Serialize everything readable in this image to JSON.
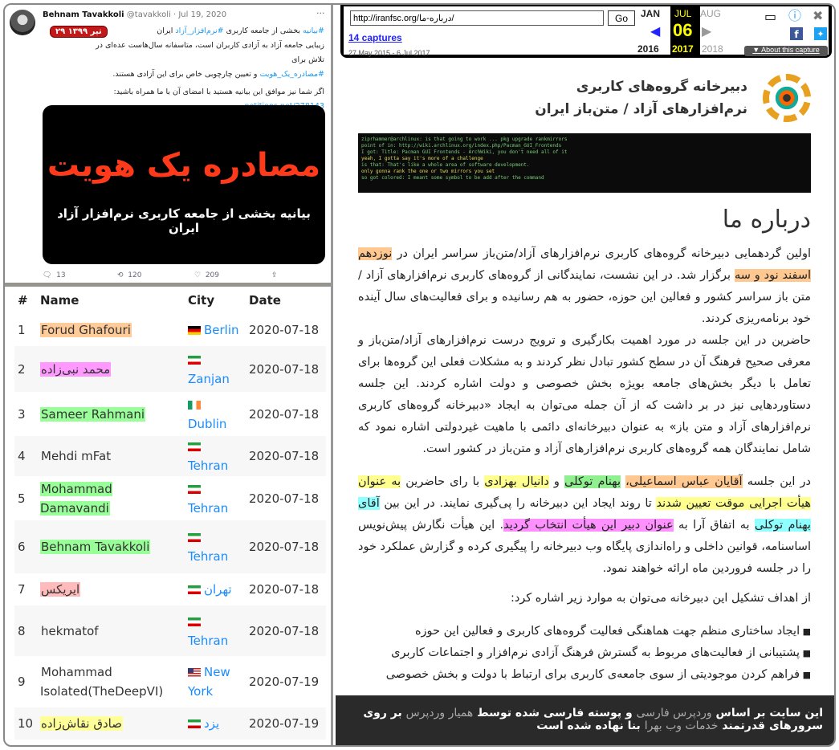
{
  "tweet": {
    "author": "Behnam Tavakkoli",
    "handle": "@tavakkoli",
    "date": "Jul 19, 2020",
    "more": "···",
    "badge": "۲۹ تیر ۱۳۹۹",
    "lines": [
      [
        {
          "t": "#بیانیه",
          "blue": true
        },
        {
          "t": " بخشی از جامعه کاربری "
        },
        {
          "t": "#نرم‌افزار_آزاد",
          "blue": true
        },
        {
          "t": " ایران"
        }
      ],
      [
        {
          "t": "زیبایی جامعه آزاد به آزادی کاربران است، متاسفانه سال‌هاست عده‌ای در تلاش برای"
        }
      ],
      [
        {
          "t": "#مصادره_یک_هویت",
          "blue": true
        },
        {
          "t": " و تعیین چارچوبی خاص برای این آزادی هستند."
        }
      ],
      [
        {
          "t": "اگر شما نیز موافق این بیانیه هستید با امضای آن با ما همراه باشید:"
        }
      ],
      [
        {
          "t": "petitions.net/278143",
          "blue": true
        }
      ]
    ],
    "image_title": "مصادره یک هویت",
    "image_subtitle": "بیانیه  بخشی از جامعه کاربری نرم‌افزار آزاد ایران",
    "replies": "13",
    "retweets": "120",
    "likes": "209"
  },
  "table": {
    "headers": [
      "#",
      "Name",
      "City",
      "Date"
    ],
    "rows": [
      {
        "n": "1",
        "name": "Forud Ghafouri",
        "hl": "#ffcc99",
        "flag": "de",
        "city": "Berlin",
        "date": "2020-07-18"
      },
      {
        "n": "2",
        "name": "محمد نبی‌زاده",
        "hl": "#ff99ff",
        "flag": "ir",
        "city": "Zanjan",
        "date": "2020-07-18",
        "wrap": true
      },
      {
        "n": "3",
        "name": "Sameer Rahmani",
        "hl": "#99ff99",
        "flag": "ie",
        "city": "Dublin",
        "date": "2020-07-18",
        "wrap": true
      },
      {
        "n": "4",
        "name": "Mehdi mFat",
        "hl": "",
        "flag": "ir",
        "city": "Tehran",
        "date": "2020-07-18",
        "wrap": true
      },
      {
        "n": "5",
        "name": "Mohammad Damavandi",
        "hl": "#99ff99",
        "flag": "ir",
        "city": "Tehran",
        "date": "2020-07-18",
        "wrap": true
      },
      {
        "n": "6",
        "name": "Behnam Tavakkoli",
        "hl": "#99ff99",
        "flag": "ir",
        "city": "Tehran",
        "date": "2020-07-18",
        "wrap": true
      },
      {
        "n": "7",
        "name": "ایریکس",
        "hl": "#ffbbbb",
        "flag": "ir",
        "city": "تهران",
        "date": "2020-07-18"
      },
      {
        "n": "8",
        "name": "hekmatof",
        "hl": "",
        "flag": "ir",
        "city": "Tehran",
        "date": "2020-07-18",
        "wrap": true
      },
      {
        "n": "9",
        "name": "Mohammad Isolated(TheDeepVI)",
        "hl": "",
        "flag": "us",
        "city": "New York",
        "date": "2020-07-19"
      },
      {
        "n": "10",
        "name": "صادق نقاش‌زاده",
        "hl": "#ffff99",
        "flag": "ir",
        "city": "یزد",
        "date": "2020-07-19"
      }
    ]
  },
  "wayback": {
    "url": "http://iranfsc.org/درباره-ما/",
    "go": "Go",
    "captures": "14 captures",
    "range": "27 May 2015 - 6 Jul 2017",
    "prev_month": "JAN",
    "cur_month": "JUL",
    "next_month": "AUG",
    "day": "06",
    "prev_year": "2016",
    "cur_year": "2017",
    "next_year": "2018",
    "about": "▼ About this capture"
  },
  "site": {
    "title_line1": "دبیرخانه گروه‌های کاربری",
    "title_line2": "نرم‌افزارهای آزاد / متن‌باز ایران",
    "page_title": "درباره ما",
    "paragraphs": [
      [
        {
          "t": "اولین گردهمایی دبیرخانه گروه‌های کاربری نرم‌افزارهای آزاد/متن‌باز سراسر ایران در "
        },
        {
          "t": "نوزدهم اسفند نود و سه",
          "hl": "#ffc891"
        },
        {
          "t": " برگزار شد. در این نشست، نمایندگانی از گروه‌های کاربری نرم‌افزارهای آزاد / متن باز سراسر کشور و فعالین این حوزه، حضور به هم رسانیده و برای فعالیت‌های سال آینده خود برنامه‌ریزی کردند."
        },
        {
          "br": true
        },
        {
          "t": "حاضرین در این جلسه در مورد اهمیت بکارگیری و ترویج درست نرم‌افزارهای آزاد/متن‌باز و معرفی صحیح فرهنگ آن در سطح کشور تبادل نظر کردند و به مشکلات فعلی این گروه‌ها برای تعامل با دیگر بخش‌های جامعه بویژه بخش خصوصی و دولت اشاره کردند. این جلسه دستاوردهایی نیز در بر داشت که از آن جمله می‌توان به ایجاد «دبیرخانه گروه‌های کاربری نرم‌افزارهای آزاد و متن باز» به عنوان دبیرخانه‌ای دائمی با ماهیت غیردولتی اشاره نمود که شامل نمایندگان همه گروه‌های کاربری نرم‌افزارهای آزاد و متن‌باز در کشور است."
        }
      ],
      [
        {
          "t": "در این جلسه "
        },
        {
          "t": "آقایان عباس اسماعیلی،",
          "hl": "#ffc891"
        },
        {
          "t": " "
        },
        {
          "t": "بهنام توکلی",
          "hl": "#90f090"
        },
        {
          "t": " و "
        },
        {
          "t": "دانیال بهزادی",
          "hl": "#ffff90"
        },
        {
          "t": " با رای حاضرین "
        },
        {
          "t": "به عنوان هیأت اجرایی موقت تعیین شدند",
          "hl": "#ffff90"
        },
        {
          "t": " تا روند ایجاد این دبیرخانه را پی‌گیری نمایند. در این بین "
        },
        {
          "t": "آقای بهنام توکلی",
          "hl": "#90ffff"
        },
        {
          "t": " به اتفاق آرا به "
        },
        {
          "t": "عنوان دبیر این هیأت انتخاب گردید",
          "hl": "#ff90ff"
        },
        {
          "t": ". این هیأت نگارش پیش‌نویس اساسنامه، قوانین داخلی و راه‌اندازی پایگاه وب دبیرخانه را پیگیری کرده و گزارش عملکرد خود را در جلسه فروردین ماه ارائه خواهند نمود."
        }
      ],
      [
        {
          "t": "از اهداف تشکیل این دبیرخانه می‌توان به موارد زیر اشاره کرد:"
        }
      ]
    ],
    "goals": [
      "ایجاد ساختاری منظم جهت هماهنگی فعالیت گروه‌های کاربری و فعالین این حوزه",
      "پشتیبانی از فعالیت‌های مربوط به گسترش فرهنگ آزادی نرم‌افزار و اجتماعات کاربری",
      "فراهم کردن موجودیتی از سوی جامعه‌ی کاربری برای ارتباط با دولت و بخش خصوصی"
    ],
    "footer": [
      {
        "t": "این سایت بر اساس "
      },
      {
        "t": "وردپرس فارسی",
        "link": true
      },
      {
        "t": " و پوسته فارسی شده توسط "
      },
      {
        "t": "همیار وردپرس",
        "link": true
      },
      {
        "t": " بر روی سرورهای قدرتمند "
      },
      {
        "t": "خدمات وب بهرا",
        "link": true
      },
      {
        "t": " بنا نهاده شده است"
      }
    ]
  }
}
